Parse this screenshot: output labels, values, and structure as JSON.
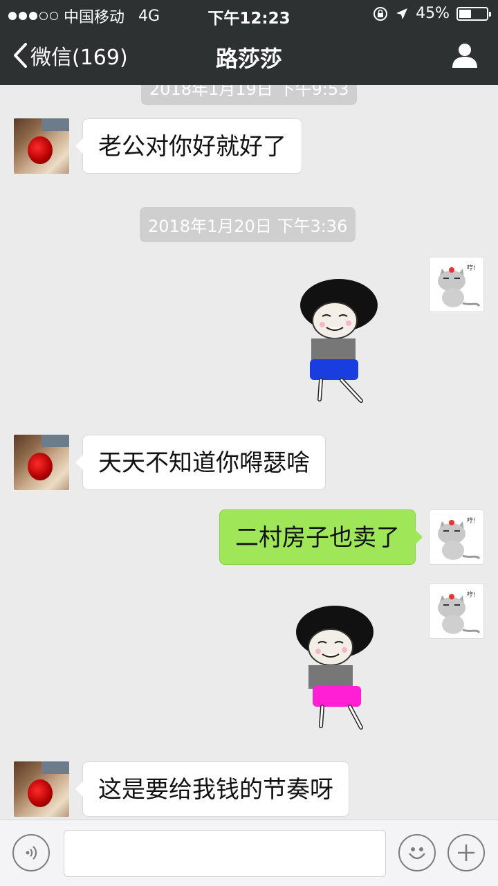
{
  "status_bar": {
    "carrier": "中国移动",
    "network": "4G",
    "time": "下午12:23",
    "battery_percent": "45%",
    "battery_level": 0.45
  },
  "nav": {
    "back_label": "微信(169)",
    "title": "路莎莎"
  },
  "messages": [
    {
      "type": "timestamp",
      "text": "2018年1月19日 下午9:53"
    },
    {
      "type": "text",
      "side": "left",
      "text": "老公对你好就好了"
    },
    {
      "type": "timestamp",
      "text": "2018年1月20日 下午3:36"
    },
    {
      "type": "sticker",
      "side": "right",
      "sticker": "mushroom-head-boy-blue-shorts"
    },
    {
      "type": "text",
      "side": "left",
      "text": "天天不知道你嘚瑟啥"
    },
    {
      "type": "text",
      "side": "right",
      "text": "二村房子也卖了"
    },
    {
      "type": "sticker",
      "side": "right",
      "sticker": "mushroom-head-boy-pink-shorts"
    },
    {
      "type": "text",
      "side": "left",
      "text": "这是要给我钱的节奏呀"
    }
  ],
  "input_bar": {
    "voice_icon": "voice-icon",
    "emoji_icon": "emoji-icon",
    "plus_icon": "plus-icon"
  },
  "colors": {
    "nav_bg": "#2e3132",
    "chat_bg": "#ebebeb",
    "outgoing_bubble": "#9fe658",
    "incoming_bubble": "#ffffff"
  }
}
